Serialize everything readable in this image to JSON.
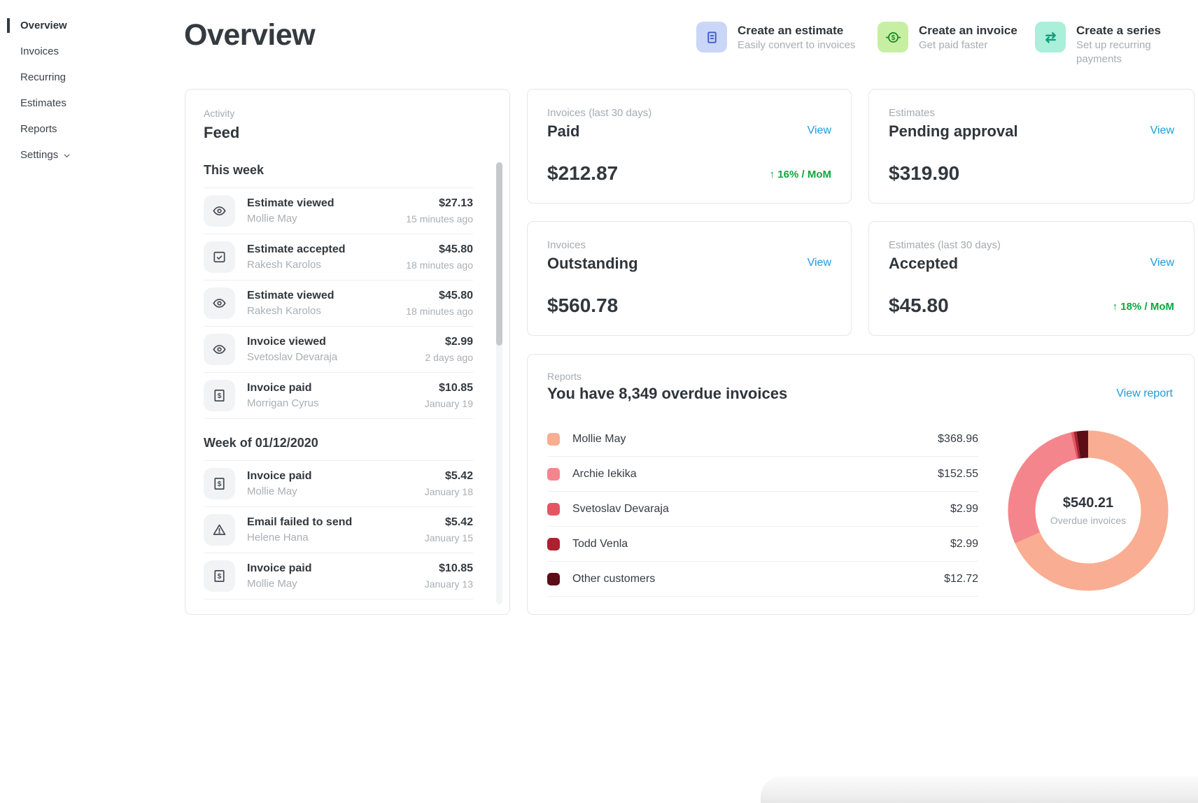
{
  "sidebar": {
    "items": [
      {
        "label": "Overview",
        "active": true
      },
      {
        "label": "Invoices",
        "active": false
      },
      {
        "label": "Recurring",
        "active": false
      },
      {
        "label": "Estimates",
        "active": false
      },
      {
        "label": "Reports",
        "active": false
      },
      {
        "label": "Settings",
        "active": false,
        "chevron": true
      }
    ]
  },
  "header": {
    "title": "Overview"
  },
  "quick_actions": [
    {
      "title": "Create an estimate",
      "subtitle": "Easily convert to invoices",
      "icon": "document-icon",
      "icon_bg": "#c9d6f8",
      "icon_color": "#3d5cc9"
    },
    {
      "title": "Create an invoice",
      "subtitle": "Get paid faster",
      "icon": "dollar-circle-icon",
      "icon_bg": "#c7efa3",
      "icon_color": "#1f8a2e"
    },
    {
      "title": "Create a series",
      "subtitle": "Set up recurring payments",
      "icon": "swap-arrows-icon",
      "icon_bg": "#a9efd9",
      "icon_color": "#0b9f7b"
    }
  ],
  "feed": {
    "label": "Activity",
    "title": "Feed",
    "sections": [
      {
        "heading": "This week",
        "items": [
          {
            "icon": "eye-icon",
            "title": "Estimate viewed",
            "subtitle": "Mollie May",
            "amount": "$27.13",
            "time": "15 minutes ago"
          },
          {
            "icon": "estimate-accepted-icon",
            "title": "Estimate accepted",
            "subtitle": "Rakesh Karolos",
            "amount": "$45.80",
            "time": "18 minutes ago"
          },
          {
            "icon": "eye-icon",
            "title": "Estimate viewed",
            "subtitle": "Rakesh Karolos",
            "amount": "$45.80",
            "time": "18 minutes ago"
          },
          {
            "icon": "eye-icon",
            "title": "Invoice viewed",
            "subtitle": "Svetoslav Devaraja",
            "amount": "$2.99",
            "time": "2 days ago"
          },
          {
            "icon": "invoice-paid-icon",
            "title": "Invoice paid",
            "subtitle": "Morrigan Cyrus",
            "amount": "$10.85",
            "time": "January 19"
          }
        ]
      },
      {
        "heading": "Week of 01/12/2020",
        "items": [
          {
            "icon": "invoice-paid-icon",
            "title": "Invoice paid",
            "subtitle": "Mollie May",
            "amount": "$5.42",
            "time": "January 18"
          },
          {
            "icon": "warning-icon",
            "title": "Email failed to send",
            "subtitle": "Helene Hana",
            "amount": "$5.42",
            "time": "January 15"
          },
          {
            "icon": "invoice-paid-icon",
            "title": "Invoice paid",
            "subtitle": "Mollie May",
            "amount": "$10.85",
            "time": "January 13"
          }
        ]
      }
    ]
  },
  "stat_cards": [
    {
      "category": "Invoices (last 30 days)",
      "title": "Paid",
      "value": "$212.87",
      "link": "View",
      "trend": "↑ 16% / MoM"
    },
    {
      "category": "Estimates",
      "title": "Pending approval",
      "value": "$319.90",
      "link": "View"
    },
    {
      "category": "Invoices",
      "title": "Outstanding",
      "value": "$560.78",
      "link": "View"
    },
    {
      "category": "Estimates (last 30 days)",
      "title": "Accepted",
      "value": "$45.80",
      "link": "View",
      "trend": "↑ 18% / MoM"
    }
  ],
  "reports": {
    "label": "Reports",
    "title": "You have 8,349 overdue invoices",
    "link": "View report"
  },
  "chart_data": {
    "type": "pie",
    "title": "You have 8,349 overdue invoices",
    "categories": [
      "Mollie May",
      "Archie Iekika",
      "Svetoslav Devaraja",
      "Todd Venla",
      "Other customers"
    ],
    "values": [
      368.96,
      152.55,
      2.99,
      2.99,
      12.72
    ],
    "labels": [
      "$368.96",
      "$152.55",
      "$2.99",
      "$2.99",
      "$12.72"
    ],
    "colors": [
      "#f9ad92",
      "#f5858c",
      "#e25662",
      "#ac202f",
      "#5c0d16"
    ],
    "total": 540.21,
    "center_value": "$540.21",
    "center_label": "Overdue invoices",
    "legend_position": "left",
    "donut": true
  }
}
